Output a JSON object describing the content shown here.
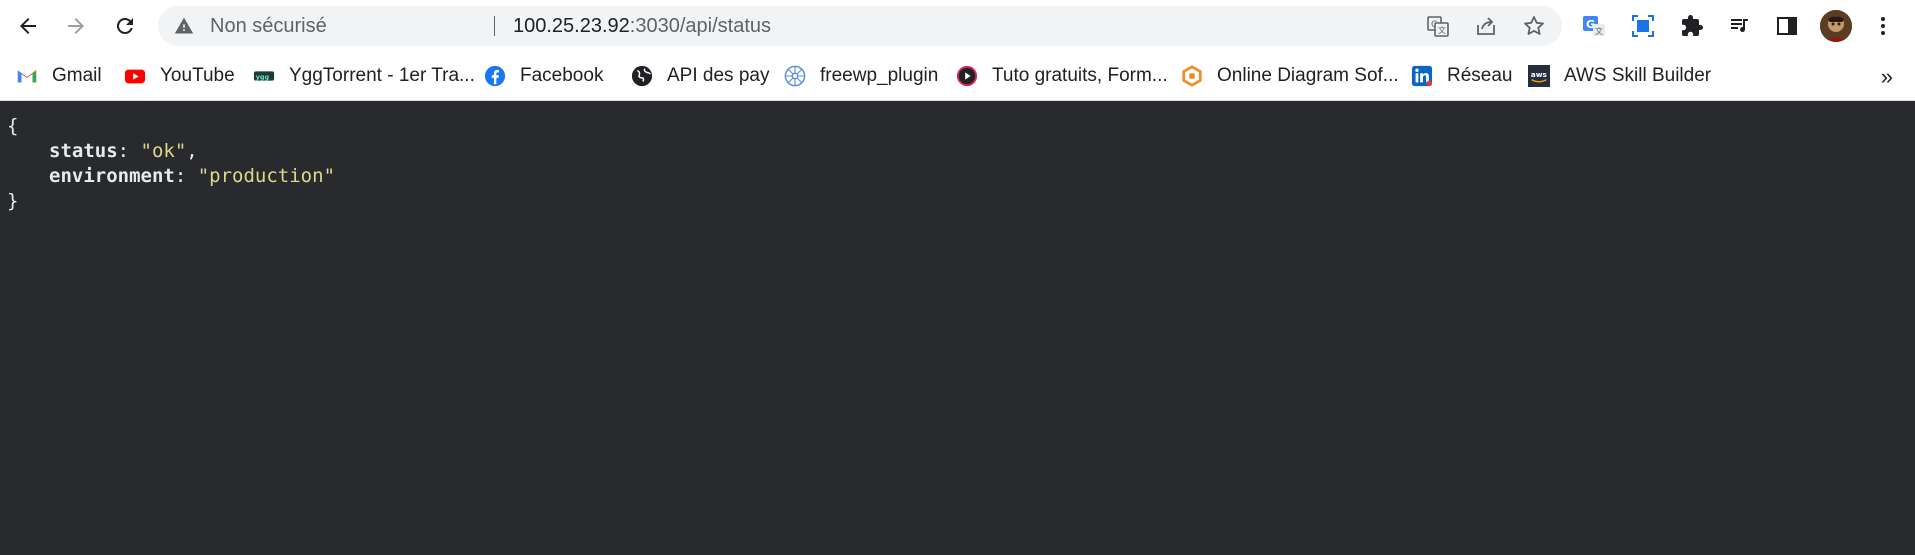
{
  "browser": {
    "security_label": "Non sécurisé",
    "url_host": "100.25.23.92",
    "url_rest": ":3030/api/status"
  },
  "bookmarks": [
    {
      "label": "Gmail",
      "icon": "gmail-icon"
    },
    {
      "label": "YouTube",
      "icon": "youtube-icon"
    },
    {
      "label": "YggTorrent - 1er Tra...",
      "icon": "yggtorrent-icon"
    },
    {
      "label": "Facebook",
      "icon": "facebook-icon"
    },
    {
      "label": "API des pay",
      "icon": "globe-icon"
    },
    {
      "label": "freewp_plugin",
      "icon": "freewp-icon"
    },
    {
      "label": "Tuto gratuits, Form...",
      "icon": "tuto-icon"
    },
    {
      "label": "Online Diagram Sof...",
      "icon": "diagram-icon"
    },
    {
      "label": "Réseau",
      "icon": "linkedin-icon"
    },
    {
      "label": "AWS Skill Builder",
      "icon": "aws-icon"
    }
  ],
  "json_view": {
    "open_brace": "{",
    "close_brace": "}",
    "entries": [
      {
        "key": "status",
        "value": "\"ok\"",
        "trail": ","
      },
      {
        "key": "environment",
        "value": "\"production\"",
        "trail": ""
      }
    ]
  },
  "colors": {
    "page_bg": "#292a2d",
    "string_color": "#ded78b",
    "key_color": "#e8eaed"
  }
}
